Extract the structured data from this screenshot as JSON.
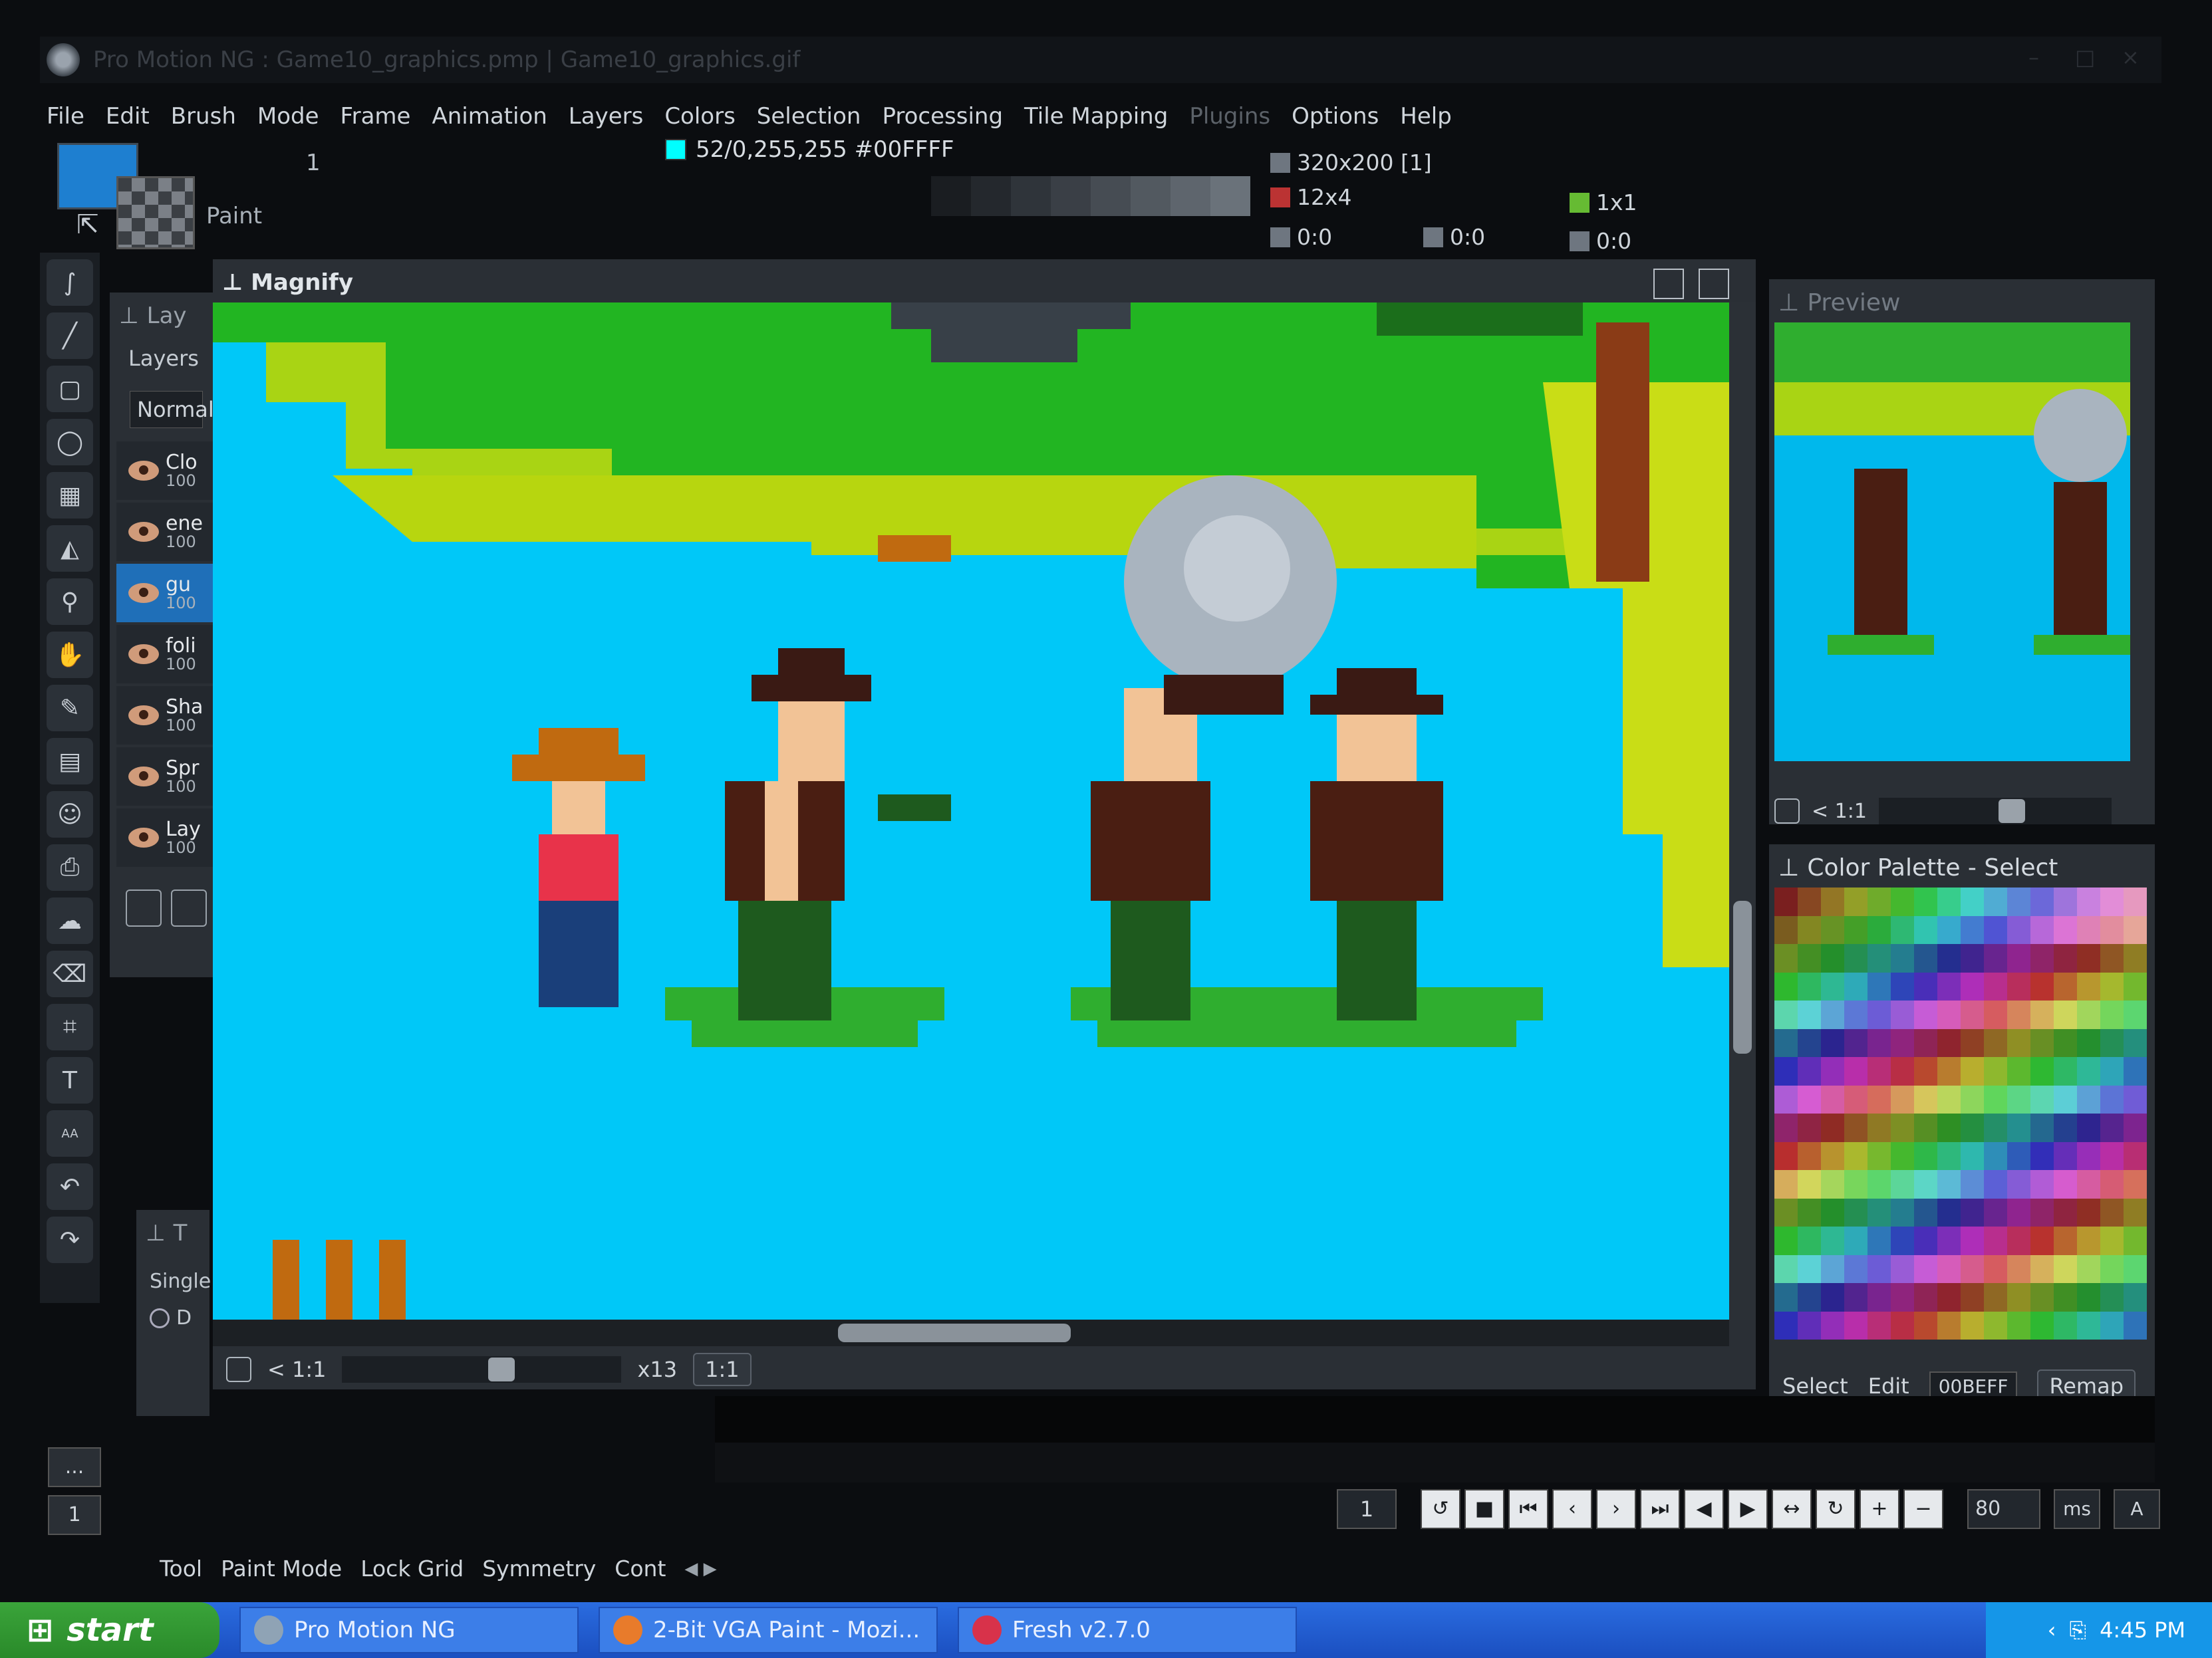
{
  "window": {
    "title": "Pro Motion NG : Game10_graphics.pmp | Game10_graphics.gif"
  },
  "menu": [
    "File",
    "Edit",
    "Brush",
    "Mode",
    "Frame",
    "Animation",
    "Layers",
    "Colors",
    "Selection",
    "Processing",
    "Tile Mapping",
    "Plugins",
    "Options",
    "Help"
  ],
  "menu_disabled": [
    "Plugins"
  ],
  "toolbar": {
    "paint_label": "Paint",
    "brush_size": "1",
    "color_info": "52/0,255,255 #00FFFF",
    "resolution": "320x200 [1]",
    "brush_dim": "12x4",
    "grid": "1x1",
    "coord1": "0:0",
    "coord2": "0:0",
    "coord3": "0:0"
  },
  "layers": {
    "title": "Layers",
    "panel_title": "Lay",
    "blend_mode": "Normal",
    "items": [
      {
        "name": "Clo",
        "opacity": "100"
      },
      {
        "name": "ene",
        "opacity": "100"
      },
      {
        "name": "gu",
        "opacity": "100",
        "active": true
      },
      {
        "name": "foli",
        "opacity": "100"
      },
      {
        "name": "Sha",
        "opacity": "100"
      },
      {
        "name": "Spr",
        "opacity": "100"
      },
      {
        "name": "Lay",
        "opacity": "100"
      }
    ]
  },
  "magnify": {
    "title": "Magnify",
    "ratio": "< 1:1",
    "zoom": "x13",
    "one_to_one": "1:1"
  },
  "preview": {
    "title": "Preview",
    "ratio": "< 1:1"
  },
  "palette": {
    "title": "Color Palette - Select",
    "select": "Select",
    "edit": "Edit",
    "hex": "00BEFF",
    "remap": "Remap"
  },
  "tool_panel": {
    "title": "T",
    "single": "Single",
    "option": "D"
  },
  "animation": {
    "frame": "1",
    "speed": "80",
    "unit": "ms",
    "auto": "A",
    "left_frame": "1",
    "dots": "..."
  },
  "tabs": [
    "Tool",
    "Paint Mode",
    "Lock Grid",
    "Symmetry",
    "Cont"
  ],
  "taskbar": {
    "start": "start",
    "tasks": [
      "Pro Motion NG",
      "2-Bit VGA Paint - Mozi...",
      "Fresh v2.7.0"
    ],
    "time": "4:45 PM"
  },
  "colors": {
    "accent": "#1e7fd0",
    "canvas_bg": "#00c8f8",
    "grass": "#2fae2f"
  }
}
